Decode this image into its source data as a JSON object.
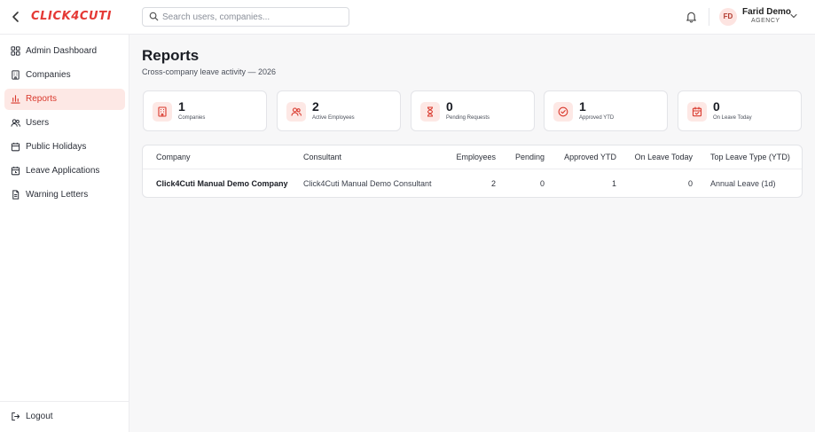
{
  "header": {
    "logo_text": "CLICK4CUTI",
    "search_placeholder": "Search users, companies...",
    "user_initials": "FD",
    "user_name": "Farid Demo",
    "user_role": "AGENCY",
    "icons": [
      "back-arrow-icon",
      "search-icon",
      "bell-icon",
      "chevron-down-icon"
    ]
  },
  "sidebar": {
    "items": [
      {
        "label": "Admin Dashboard",
        "icon": "dashboard-icon"
      },
      {
        "label": "Companies",
        "icon": "building-icon"
      },
      {
        "label": "Reports",
        "icon": "bar-chart-icon",
        "active": true
      },
      {
        "label": "Users",
        "icon": "users-icon"
      },
      {
        "label": "Public Holidays",
        "icon": "calendar-icon"
      },
      {
        "label": "Leave Applications",
        "icon": "calendar-clock-icon"
      },
      {
        "label": "Warning Letters",
        "icon": "document-icon"
      }
    ],
    "logout_label": "Logout"
  },
  "main": {
    "title": "Reports",
    "subtitle": "Cross-company leave activity — 2026",
    "stats": [
      {
        "value": "1",
        "label": "Companies",
        "icon": "building-icon"
      },
      {
        "value": "2",
        "label": "Active Employees",
        "icon": "users-icon"
      },
      {
        "value": "0",
        "label": "Pending Requests",
        "icon": "hourglass-icon"
      },
      {
        "value": "1",
        "label": "Approved YTD",
        "icon": "check-circle-icon"
      },
      {
        "value": "0",
        "label": "On Leave Today",
        "icon": "calendar-check-icon"
      }
    ],
    "table": {
      "headers": [
        "Company",
        "Consultant",
        "Employees",
        "Pending",
        "Approved YTD",
        "On Leave Today",
        "Top Leave Type (YTD)"
      ],
      "rows": [
        [
          "Click4Cuti Manual Demo Company",
          "Click4Cuti Manual Demo Consultant",
          "2",
          "0",
          "1",
          "0",
          "Annual Leave (1d)"
        ]
      ]
    }
  },
  "colors": {
    "accent": "#d9382c",
    "accent_bg": "#fde8e5"
  }
}
